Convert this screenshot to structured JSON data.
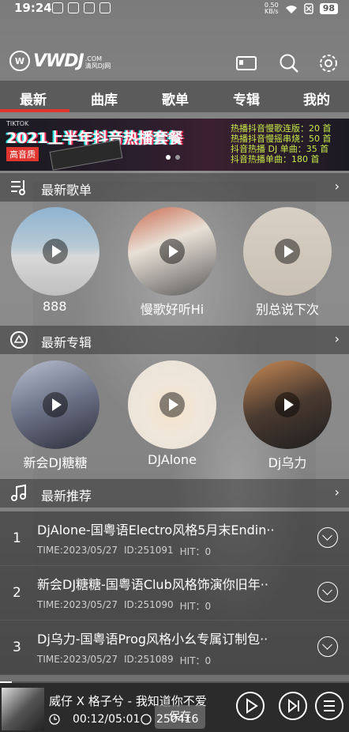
{
  "status_bar": {
    "time": "19:24",
    "net_speed_value": "0.50",
    "net_speed_unit": "KB/s",
    "battery": "98"
  },
  "header": {
    "logo_text": "VWDJ",
    "logo_domain": ".COM",
    "logo_sub": "清风DJ网"
  },
  "tabs": [
    {
      "label": "最新",
      "active": true
    },
    {
      "label": "曲库"
    },
    {
      "label": "歌单"
    },
    {
      "label": "专辑"
    },
    {
      "label": "我的"
    }
  ],
  "banner": {
    "tag": "TIKTOK",
    "title": "2021上半年抖音热播套餐",
    "badge": "高音质",
    "lines": [
      "热播抖音慢歌连版：20 首",
      "热播抖音慢摇串烧：50 首",
      "抖音热播 DJ 单曲：35 首",
      "抖音热播单曲：180 首"
    ]
  },
  "sections": {
    "new_songs": {
      "title": "最新歌单",
      "more": "›",
      "items": [
        {
          "label": "888"
        },
        {
          "label": "慢歌好听Hi"
        },
        {
          "label": "别总说下次"
        }
      ]
    },
    "new_albums": {
      "title": "最新专辑",
      "more": "›",
      "items": [
        {
          "label": "新会DJ糖糖"
        },
        {
          "label": "DJAlone"
        },
        {
          "label": "Dj乌力"
        }
      ]
    },
    "recommend": {
      "title": "最新推荐",
      "more": "›",
      "items": [
        {
          "index": "1",
          "title": "DjAlone-国粤语Electro风格5月末Endin··",
          "time": "TIME:2023/05/27",
          "id": "ID:251091",
          "hit": "HIT：0"
        },
        {
          "index": "2",
          "title": "新会DJ糖糖-国粤语Club风格饰演你旧年··",
          "time": "TIME:2023/05/27",
          "id": "ID:251090",
          "hit": "HIT：0"
        },
        {
          "index": "3",
          "title": "Dj乌力-国粤语Prog风格小幺专属订制包··",
          "time": "TIME:2023/05/27",
          "id": "ID:251089",
          "hit": "HIT：0"
        }
      ]
    }
  },
  "player": {
    "title": "威仔 X 格子兮 - 我知道你不爱",
    "time": "00:12/05:01",
    "id": "250416",
    "save_label": "保存"
  },
  "colors": {
    "accent": "#e0362f"
  }
}
